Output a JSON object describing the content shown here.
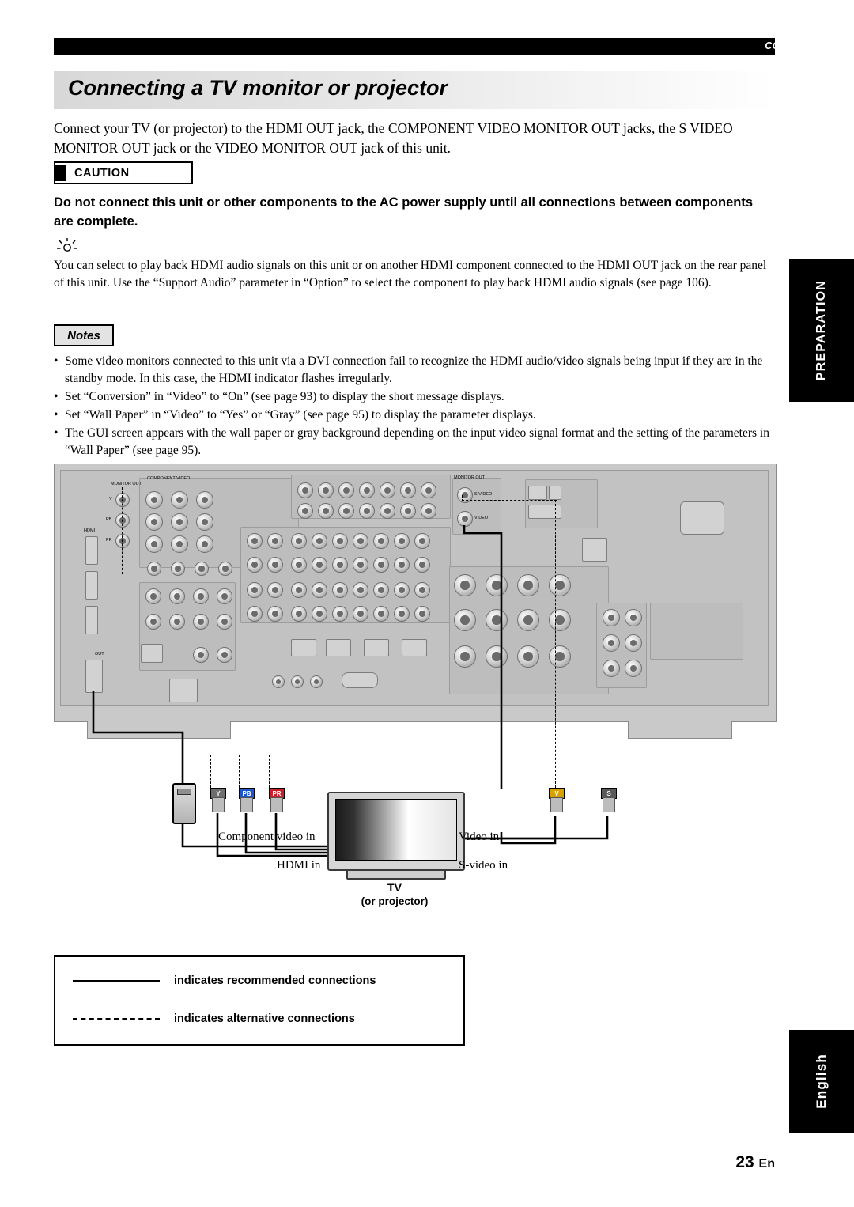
{
  "header": {
    "section_label": "CONNECTIONS"
  },
  "title": "Connecting a TV monitor or projector",
  "intro": "Connect your TV (or projector) to the HDMI OUT jack, the COMPONENT VIDEO MONITOR OUT jacks, the S VIDEO MONITOR OUT jack or the VIDEO MONITOR OUT jack of this unit.",
  "caution": {
    "label": "CAUTION",
    "body": "Do not connect this unit or other components to the AC power supply until all connections between components are complete."
  },
  "tip": "You can select to play back HDMI audio signals on this unit or on another HDMI component connected to the HDMI OUT jack on the rear panel of this unit. Use the “Support Audio” parameter in “Option” to select the component to play back HDMI audio signals (see page 106).",
  "notes": {
    "label": "Notes",
    "items": [
      "Some video monitors connected to this unit via a DVI connection fail to recognize the HDMI audio/video signals being input if they are in the standby mode. In this case, the HDMI indicator flashes irregularly.",
      "Set “Conversion” in “Video” to “On” (see page 93) to display the short message displays.",
      "Set “Wall Paper” in “Video” to “Yes” or “Gray” (see page 95) to display the parameter displays.",
      "The GUI screen appears with the wall paper or gray background depending on the input video signal format and the setting of the parameters in “Wall Paper” (see page 95)."
    ]
  },
  "diagram": {
    "rear_panel_labels": {
      "monitor_out_component": "MONITOR OUT",
      "component_video": "COMPONENT VIDEO",
      "y": "Y",
      "pb": "PB",
      "pr": "PR",
      "hdmi": "HDMI",
      "out": "OUT",
      "monitor_out_video": "MONITOR OUT",
      "s_video": "S VIDEO",
      "video": "VIDEO"
    },
    "plug_labels": {
      "y": "Y",
      "pb": "PB",
      "pr": "PR",
      "v": "V",
      "s": "S"
    },
    "tv": {
      "name": "TV",
      "sub": "(or projector)"
    },
    "connection_labels": {
      "component_video_in": "Component video in",
      "hdmi_in": "HDMI in",
      "video_in": "Video in",
      "s_video_in": "S-video in"
    }
  },
  "legend": {
    "solid": "indicates recommended connections",
    "dashed": "indicates alternative connections"
  },
  "side_tabs": {
    "preparation": "PREPARATION",
    "english": "English"
  },
  "page": {
    "number": "23",
    "lang": "En"
  }
}
